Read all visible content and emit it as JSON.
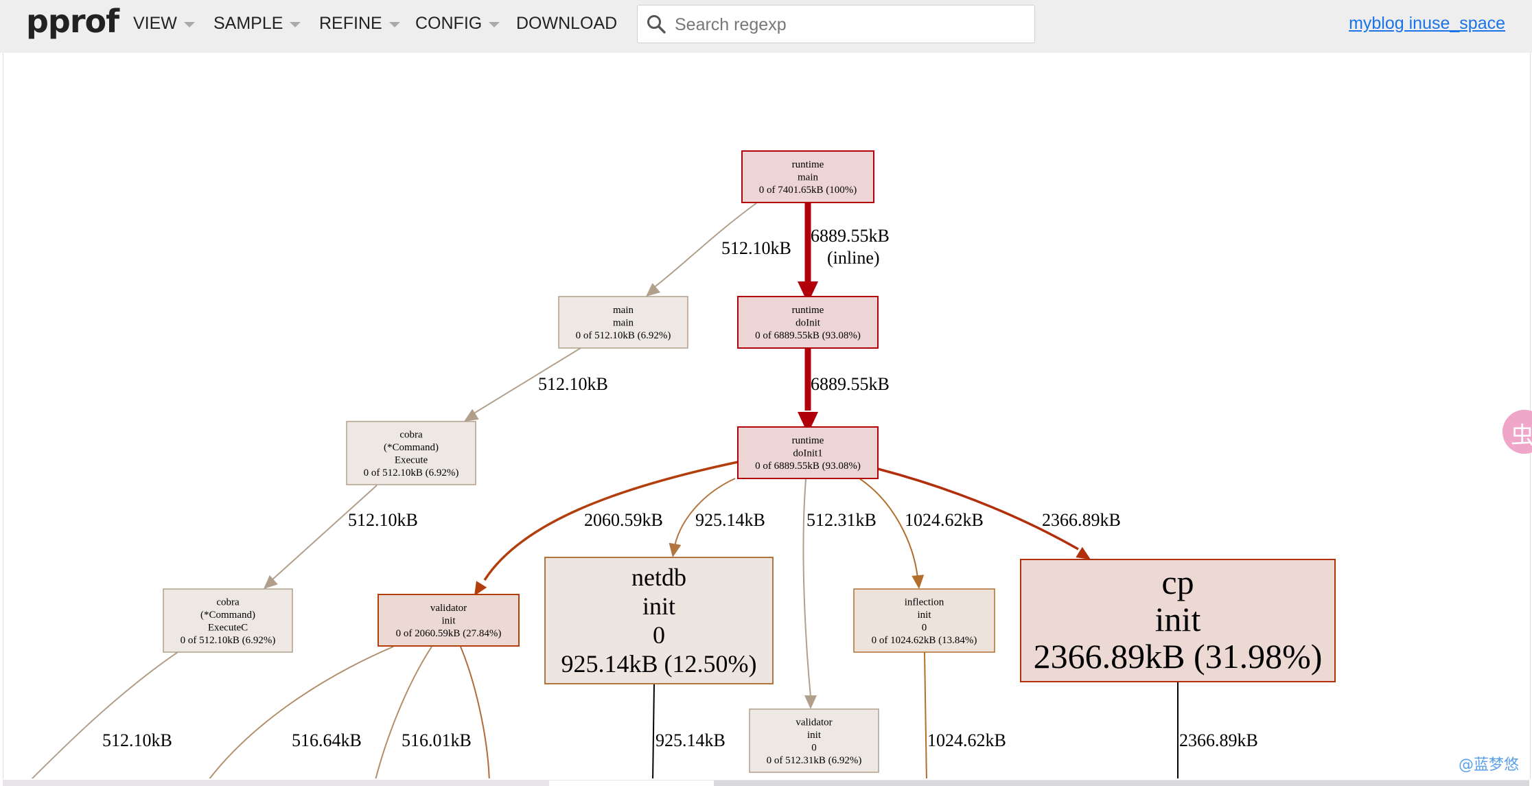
{
  "app": {
    "logo": "pprof",
    "menu": {
      "view": "VIEW",
      "sample": "SAMPLE",
      "refine": "REFINE",
      "config": "CONFIG",
      "download": "DOWNLOAD"
    },
    "search": {
      "placeholder": "Search regexp",
      "value": ""
    },
    "title_link": "myblog inuse_space",
    "watermark": "@蓝梦悠",
    "side_bubble": "虫"
  },
  "graph": {
    "nodes": [
      {
        "id": "runtime_main",
        "lines": [
          "runtime",
          "main",
          "0 of 7401.65kB (100%)"
        ],
        "fill": "#edd5d5",
        "stroke": "#b2000a"
      },
      {
        "id": "main_main",
        "lines": [
          "main",
          "main",
          "0 of 512.10kB (6.92%)"
        ],
        "fill": "#ede8e3",
        "stroke": "#b29f8b"
      },
      {
        "id": "runtime_doInit",
        "lines": [
          "runtime",
          "doInit",
          "0 of 6889.55kB (93.08%)"
        ],
        "fill": "#edd5d5",
        "stroke": "#b2000a"
      },
      {
        "id": "cobra_execute",
        "lines": [
          "cobra",
          "(*Command)",
          "Execute",
          "0 of 512.10kB (6.92%)"
        ],
        "fill": "#ede8e3",
        "stroke": "#b29f8b"
      },
      {
        "id": "runtime_doInit1",
        "lines": [
          "runtime",
          "doInit1",
          "0 of 6889.55kB (93.08%)"
        ],
        "fill": "#edd5d5",
        "stroke": "#b2000a"
      },
      {
        "id": "cobra_executec",
        "lines": [
          "cobra",
          "(*Command)",
          "ExecuteC",
          "0 of 512.10kB (6.92%)"
        ],
        "fill": "#ede8e3",
        "stroke": "#b29f8b"
      },
      {
        "id": "validator_init",
        "lines": [
          "validator",
          "init",
          "0 of 2060.59kB (27.84%)"
        ],
        "fill": "#edd9d3",
        "stroke": "#b23e0b"
      },
      {
        "id": "netdb_init",
        "lines": [
          "netdb",
          "init",
          "0",
          "925.14kB (12.50%)"
        ],
        "fill": "#ede5e0",
        "stroke": "#b27540"
      },
      {
        "id": "inflection_init",
        "lines": [
          "inflection",
          "init",
          "0",
          "0 of 1024.62kB (13.84%)"
        ],
        "fill": "#ede3db",
        "stroke": "#b26d2a"
      },
      {
        "id": "cp_init",
        "lines": [
          "cp",
          "init",
          "2366.89kB (31.98%)"
        ],
        "fill": "#edd9d4",
        "stroke": "#b22f0b"
      },
      {
        "id": "validator_init0",
        "lines": [
          "validator",
          "init",
          "0",
          "0 of 512.31kB (6.92%)"
        ],
        "fill": "#ede8e3",
        "stroke": "#b29f8b"
      }
    ],
    "edges": [
      {
        "id": "e_main_mainmain",
        "label": [
          "512.10kB"
        ],
        "color": "#b29f8b"
      },
      {
        "id": "e_main_doinit",
        "label": [
          "6889.55kB",
          "(inline)"
        ],
        "color": "#b2000a"
      },
      {
        "id": "e_mainmain_execute",
        "label": [
          "512.10kB"
        ],
        "color": "#b29f8b"
      },
      {
        "id": "e_doinit_doinit1",
        "label": [
          "6889.55kB"
        ],
        "color": "#b2000a"
      },
      {
        "id": "e_execute_executec",
        "label": [
          "512.10kB"
        ],
        "color": "#b29f8b"
      },
      {
        "id": "e_doinit1_validator",
        "label": [
          "2060.59kB"
        ],
        "color": "#b23e0b"
      },
      {
        "id": "e_doinit1_netdb",
        "label": [
          "925.14kB"
        ],
        "color": "#b27540"
      },
      {
        "id": "e_doinit1_validator0",
        "label": [
          "512.31kB"
        ],
        "color": "#b29f8b"
      },
      {
        "id": "e_doinit1_inflection",
        "label": [
          "1024.62kB"
        ],
        "color": "#b26d2a"
      },
      {
        "id": "e_doinit1_cp",
        "label": [
          "2366.89kB"
        ],
        "color": "#b22f0b"
      },
      {
        "id": "e_executec_down",
        "label": [
          "512.10kB"
        ],
        "color": "#b29f8b"
      },
      {
        "id": "e_validator_a",
        "label": [
          "516.64kB"
        ],
        "color": "#b28e6a"
      },
      {
        "id": "e_validator_b",
        "label": [
          "516.01kB"
        ],
        "color": "#b28e6a"
      },
      {
        "id": "e_validator_c",
        "label": [],
        "color": "#b26a3a"
      },
      {
        "id": "e_netdb_down",
        "label": [
          "925.14kB"
        ],
        "color": "#000000"
      },
      {
        "id": "e_inflection_down",
        "label": [
          "1024.62kB"
        ],
        "color": "#b26d2a"
      },
      {
        "id": "e_cp_down",
        "label": [
          "2366.89kB"
        ],
        "color": "#000000"
      }
    ]
  }
}
